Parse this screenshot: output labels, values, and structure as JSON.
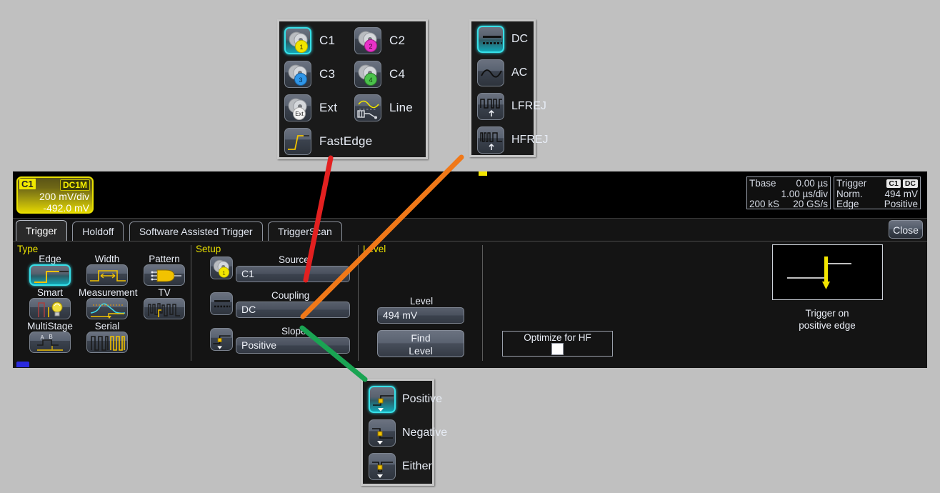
{
  "source_popup": {
    "name": "source-selection-popup",
    "items": [
      {
        "id": "c1",
        "label": "C1",
        "icon": "channel-1-probe-icon",
        "selected": true
      },
      {
        "id": "c2",
        "label": "C2",
        "icon": "channel-2-probe-icon",
        "selected": false
      },
      {
        "id": "c3",
        "label": "C3",
        "icon": "channel-3-probe-icon",
        "selected": false
      },
      {
        "id": "c4",
        "label": "C4",
        "icon": "channel-4-probe-icon",
        "selected": false
      },
      {
        "id": "ext",
        "label": "Ext",
        "icon": "external-probe-icon",
        "selected": false
      },
      {
        "id": "line",
        "label": "Line",
        "icon": "line-power-icon",
        "selected": false
      },
      {
        "id": "fastedge",
        "label": "FastEdge",
        "icon": "fast-edge-icon",
        "selected": false
      }
    ]
  },
  "coupling_popup": {
    "name": "coupling-selection-popup",
    "items": [
      {
        "id": "dc",
        "label": "DC",
        "icon": "dc-coupling-icon",
        "selected": true
      },
      {
        "id": "ac",
        "label": "AC",
        "icon": "ac-coupling-icon",
        "selected": false
      },
      {
        "id": "lfrej",
        "label": "LFREJ",
        "icon": "low-frequency-reject-icon",
        "selected": false
      },
      {
        "id": "hfrej",
        "label": "HFREJ",
        "icon": "high-frequency-reject-icon",
        "selected": false
      }
    ]
  },
  "slope_popup": {
    "name": "slope-selection-popup",
    "items": [
      {
        "id": "positive",
        "label": "Positive",
        "icon": "slope-positive-icon",
        "selected": true
      },
      {
        "id": "negative",
        "label": "Negative",
        "icon": "slope-negative-icon",
        "selected": false
      },
      {
        "id": "either",
        "label": "Either",
        "icon": "slope-either-icon",
        "selected": false
      }
    ]
  },
  "channel_readout": {
    "channel": "C1",
    "coupling": "DC1M",
    "vertical_scale": "200 mV/div",
    "offset": "-492.0 mV"
  },
  "timebase_readout": {
    "title": "Tbase",
    "delay": "0.00 µs",
    "scale": "1.00 µs/div",
    "memory": "200 kS",
    "sample_rate": "20 GS/s"
  },
  "trigger_readout": {
    "title": "Trigger",
    "source_tag": "C1",
    "coupling_tag": "DC",
    "mode": "Norm.",
    "level": "494 mV",
    "type": "Edge",
    "slope": "Positive"
  },
  "tabs": [
    {
      "id": "trigger",
      "label": "Trigger",
      "active": true
    },
    {
      "id": "holdoff",
      "label": "Holdoff",
      "active": false
    },
    {
      "id": "software-assisted-trigger",
      "label": "Software Assisted Trigger",
      "active": false
    },
    {
      "id": "triggerscan",
      "label": "TriggerScan",
      "active": false
    }
  ],
  "close_label": "Close",
  "type_section": {
    "title": "Type",
    "items": [
      {
        "id": "edge",
        "label": "Edge",
        "icon": "trigger-edge-icon",
        "selected": true
      },
      {
        "id": "width",
        "label": "Width",
        "icon": "trigger-width-icon",
        "selected": false
      },
      {
        "id": "pattern",
        "label": "Pattern",
        "icon": "trigger-pattern-icon",
        "selected": false
      },
      {
        "id": "smart",
        "label": "Smart",
        "icon": "trigger-smart-icon",
        "selected": false
      },
      {
        "id": "measurement",
        "label": "Measurement",
        "icon": "trigger-measurement-icon",
        "selected": false
      },
      {
        "id": "tv",
        "label": "TV",
        "icon": "trigger-tv-icon",
        "selected": false
      },
      {
        "id": "multistage",
        "label": "MultiStage",
        "icon": "trigger-multistage-icon",
        "selected": false
      },
      {
        "id": "serial",
        "label": "Serial",
        "icon": "trigger-serial-icon",
        "selected": false
      }
    ]
  },
  "setup_section": {
    "title": "Setup",
    "source": {
      "label": "Source",
      "value": "C1",
      "icon": "channel-1-probe-icon"
    },
    "coupling": {
      "label": "Coupling",
      "value": "DC",
      "icon": "dc-coupling-icon"
    },
    "slope": {
      "label": "Slope",
      "value": "Positive",
      "icon": "slope-positive-icon"
    }
  },
  "level_section": {
    "title": "Level",
    "level_label": "Level",
    "level_value": "494 mV",
    "find_level_line1": "Find",
    "find_level_line2": "Level"
  },
  "right_section": {
    "optimize_hf_label": "Optimize for HF",
    "optimize_hf_checked": false,
    "preview_caption_line1": "Trigger on",
    "preview_caption_line2": "positive edge"
  },
  "annotations": [
    {
      "id": "source-callout",
      "color": "#e32020",
      "from": "source-field",
      "to": "source-popup"
    },
    {
      "id": "coupling-callout",
      "color": "#f07818",
      "from": "coupling-field",
      "to": "coupling-popup"
    },
    {
      "id": "slope-callout",
      "color": "#1aa453",
      "from": "slope-field",
      "to": "slope-popup"
    }
  ],
  "colors": {
    "desktop": "#c0c0c0",
    "scope_background": "#000000",
    "dialog_background": "#141414",
    "accent_yellow": "#e8e000",
    "selection_cyan": "#37e0e8",
    "channel1": "#f2e500"
  }
}
